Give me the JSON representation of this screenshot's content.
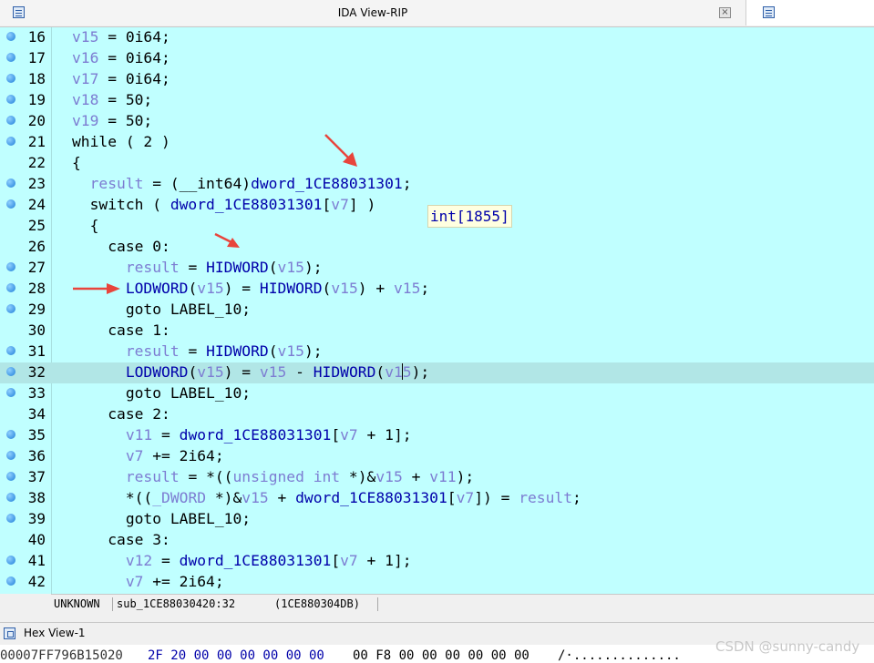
{
  "window": {
    "title": "IDA View-RIP",
    "close_glyph": "×"
  },
  "code_lines": [
    {
      "num": "16",
      "bp": true,
      "tokens": [
        [
          "v",
          "v15"
        ],
        [
          "t",
          " = 0i64;"
        ]
      ]
    },
    {
      "num": "17",
      "bp": true,
      "tokens": [
        [
          "v",
          "v16"
        ],
        [
          "t",
          " = 0i64;"
        ]
      ]
    },
    {
      "num": "18",
      "bp": true,
      "tokens": [
        [
          "v",
          "v17"
        ],
        [
          "t",
          " = 0i64;"
        ]
      ]
    },
    {
      "num": "19",
      "bp": true,
      "tokens": [
        [
          "v",
          "v18"
        ],
        [
          "t",
          " = 50;"
        ]
      ]
    },
    {
      "num": "20",
      "bp": true,
      "tokens": [
        [
          "v",
          "v19"
        ],
        [
          "t",
          " = 50;"
        ]
      ]
    },
    {
      "num": "21",
      "bp": true,
      "tokens": [
        [
          "t",
          "while ( 2 )"
        ]
      ]
    },
    {
      "num": "22",
      "bp": false,
      "tokens": [
        [
          "t",
          "{"
        ]
      ]
    },
    {
      "num": "23",
      "bp": true,
      "tokens": [
        [
          "t",
          "  "
        ],
        [
          "v",
          "result"
        ],
        [
          "t",
          " = (__int64)"
        ],
        [
          "g",
          "dword_1CE88031301"
        ],
        [
          "t",
          ";"
        ]
      ]
    },
    {
      "num": "24",
      "bp": true,
      "tokens": [
        [
          "t",
          "  switch ( "
        ],
        [
          "g",
          "dword_1CE88031301"
        ],
        [
          "t",
          "["
        ],
        [
          "v",
          "v7"
        ],
        [
          "t",
          "] )"
        ]
      ]
    },
    {
      "num": "25",
      "bp": false,
      "tokens": [
        [
          "t",
          "  {"
        ]
      ]
    },
    {
      "num": "26",
      "bp": false,
      "tokens": [
        [
          "t",
          "    case 0:"
        ]
      ]
    },
    {
      "num": "27",
      "bp": true,
      "tokens": [
        [
          "t",
          "      "
        ],
        [
          "v",
          "result"
        ],
        [
          "t",
          " = "
        ],
        [
          "g",
          "HIDWORD"
        ],
        [
          "t",
          "("
        ],
        [
          "v",
          "v15"
        ],
        [
          "t",
          ");"
        ]
      ]
    },
    {
      "num": "28",
      "bp": true,
      "tokens": [
        [
          "t",
          "      "
        ],
        [
          "g",
          "LODWORD"
        ],
        [
          "t",
          "("
        ],
        [
          "v",
          "v15"
        ],
        [
          "t",
          ") = "
        ],
        [
          "g",
          "HIDWORD"
        ],
        [
          "t",
          "("
        ],
        [
          "v",
          "v15"
        ],
        [
          "t",
          ") + "
        ],
        [
          "v",
          "v15"
        ],
        [
          "t",
          ";"
        ]
      ]
    },
    {
      "num": "29",
      "bp": true,
      "tokens": [
        [
          "t",
          "      goto LABEL_10;"
        ]
      ]
    },
    {
      "num": "30",
      "bp": false,
      "tokens": [
        [
          "t",
          "    case 1:"
        ]
      ]
    },
    {
      "num": "31",
      "bp": true,
      "tokens": [
        [
          "t",
          "      "
        ],
        [
          "v",
          "result"
        ],
        [
          "t",
          " = "
        ],
        [
          "g",
          "HIDWORD"
        ],
        [
          "t",
          "("
        ],
        [
          "v",
          "v15"
        ],
        [
          "t",
          ");"
        ]
      ]
    },
    {
      "num": "32",
      "bp": true,
      "hl": true,
      "tokens": [
        [
          "t",
          "      "
        ],
        [
          "g",
          "LODWORD"
        ],
        [
          "t",
          "("
        ],
        [
          "v",
          "v15"
        ],
        [
          "t",
          ") = "
        ],
        [
          "v",
          "v15"
        ],
        [
          "t",
          " - "
        ],
        [
          "g",
          "HIDWORD"
        ],
        [
          "t",
          "("
        ],
        [
          "v",
          "v1"
        ],
        [
          "caret",
          ""
        ],
        [
          "v",
          "5"
        ],
        [
          "t",
          ");"
        ]
      ]
    },
    {
      "num": "33",
      "bp": true,
      "tokens": [
        [
          "t",
          "      goto LABEL_10;"
        ]
      ]
    },
    {
      "num": "34",
      "bp": false,
      "tokens": [
        [
          "t",
          "    case 2:"
        ]
      ]
    },
    {
      "num": "35",
      "bp": true,
      "tokens": [
        [
          "t",
          "      "
        ],
        [
          "v",
          "v11"
        ],
        [
          "t",
          " = "
        ],
        [
          "g",
          "dword_1CE88031301"
        ],
        [
          "t",
          "["
        ],
        [
          "v",
          "v7"
        ],
        [
          "t",
          " + 1];"
        ]
      ]
    },
    {
      "num": "36",
      "bp": true,
      "tokens": [
        [
          "t",
          "      "
        ],
        [
          "v",
          "v7"
        ],
        [
          "t",
          " += 2i64;"
        ]
      ]
    },
    {
      "num": "37",
      "bp": true,
      "tokens": [
        [
          "t",
          "      "
        ],
        [
          "v",
          "result"
        ],
        [
          "t",
          " = *(("
        ],
        [
          "v",
          "unsigned int"
        ],
        [
          "t",
          " *)&"
        ],
        [
          "v",
          "v15"
        ],
        [
          "t",
          " + "
        ],
        [
          "v",
          "v11"
        ],
        [
          "t",
          ");"
        ]
      ]
    },
    {
      "num": "38",
      "bp": true,
      "tokens": [
        [
          "t",
          "      *(("
        ],
        [
          "v",
          "_DWORD"
        ],
        [
          "t",
          " *)&"
        ],
        [
          "v",
          "v15"
        ],
        [
          "t",
          " + "
        ],
        [
          "g",
          "dword_1CE88031301"
        ],
        [
          "t",
          "["
        ],
        [
          "v",
          "v7"
        ],
        [
          "t",
          "]) = "
        ],
        [
          "v",
          "result"
        ],
        [
          "t",
          ";"
        ]
      ]
    },
    {
      "num": "39",
      "bp": true,
      "tokens": [
        [
          "t",
          "      goto LABEL_10;"
        ]
      ]
    },
    {
      "num": "40",
      "bp": false,
      "tokens": [
        [
          "t",
          "    case 3:"
        ]
      ]
    },
    {
      "num": "41",
      "bp": true,
      "tokens": [
        [
          "t",
          "      "
        ],
        [
          "v",
          "v12"
        ],
        [
          "t",
          " = "
        ],
        [
          "g",
          "dword_1CE88031301"
        ],
        [
          "t",
          "["
        ],
        [
          "v",
          "v7"
        ],
        [
          "t",
          " + 1];"
        ]
      ]
    },
    {
      "num": "42",
      "bp": true,
      "tokens": [
        [
          "t",
          "      "
        ],
        [
          "v",
          "v7"
        ],
        [
          "t",
          " += 2i64;"
        ]
      ]
    }
  ],
  "tooltip": {
    "text": "int[1855]"
  },
  "status": {
    "segment": "UNKNOWN",
    "location": "sub_1CE88030420:32",
    "address": "(1CE880304DB)"
  },
  "hex_view": {
    "title": "Hex View-1",
    "address": "00007FF796B15020",
    "bytes_a": "2F 20 00 00 00 00 00 00",
    "bytes_b": "00 F8 00 00 00 00 00 00",
    "ascii": "/·.............."
  },
  "watermark": "CSDN @sunny-candy",
  "colors": {
    "code_background": "#c0ffff",
    "highlight_line": "#b1e6e6",
    "variable": "#7d7dd2",
    "global": "#0000aa",
    "annotation_arrow": "#e8453c"
  }
}
